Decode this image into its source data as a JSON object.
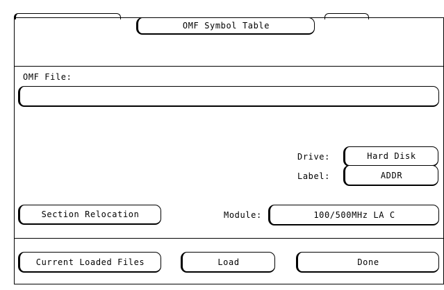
{
  "window": {
    "title": "OMF Symbol Table"
  },
  "omf_file": {
    "label": "OMF File:",
    "value": ""
  },
  "drive": {
    "label": "Drive:",
    "value": "Hard Disk"
  },
  "label_field": {
    "label": "Label:",
    "value": "ADDR"
  },
  "module": {
    "label": "Module:",
    "value": "100/500MHz LA C"
  },
  "buttons": {
    "section_relocation": "Section Relocation",
    "current_loaded_files": "Current Loaded Files",
    "load": "Load",
    "done": "Done"
  }
}
